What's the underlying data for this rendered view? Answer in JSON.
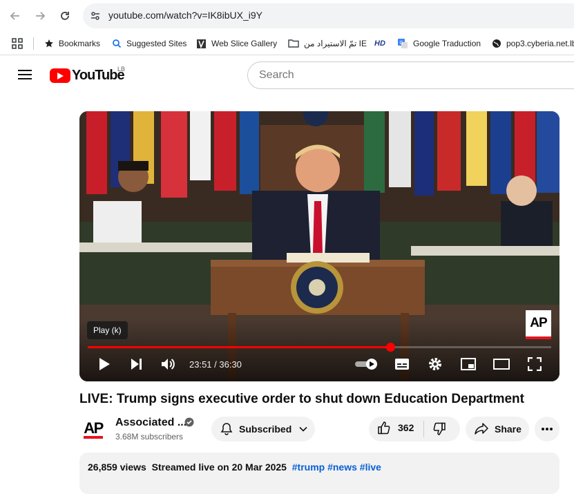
{
  "browser": {
    "url": "youtube.com/watch?v=IK8ibUX_i9Y",
    "bookmarks": [
      {
        "label": "Bookmarks",
        "icon": "star-icon"
      },
      {
        "label": "Suggested Sites",
        "icon": "search-icon"
      },
      {
        "label": "Web Slice Gallery",
        "icon": "web-slice-icon"
      },
      {
        "label": "تمّ الاستيراد من IE",
        "icon": "folder-icon"
      },
      {
        "label": "",
        "icon": "hd-icon"
      },
      {
        "label": "Google Traduction",
        "icon": "google-translate-icon"
      },
      {
        "label": "pop3.cyberia.net.lb",
        "icon": "globe-icon"
      }
    ]
  },
  "youtube": {
    "logo_text": "YouTube",
    "country_code": "LB",
    "search_placeholder": "Search"
  },
  "player": {
    "tooltip": "Play (k)",
    "time_display": "23:51 / 36:30",
    "progress_fraction": 0.6534,
    "watermark": "AP"
  },
  "video": {
    "title": "LIVE: Trump signs executive order to shut down Education Department",
    "channel_name": "Associated ...",
    "channel_avatar_text": "AP",
    "subscribers": "3.68M subscribers",
    "subscribe_label": "Subscribed",
    "likes": "362",
    "share_label": "Share",
    "views": "26,859 views",
    "streamed": "Streamed live on 20 Mar 2025",
    "hashtags": [
      "#trump",
      "#news",
      "#live"
    ]
  },
  "colors": {
    "brand_red": "#ff0000",
    "progress_red": "#f00",
    "link_blue": "#065fd4"
  }
}
